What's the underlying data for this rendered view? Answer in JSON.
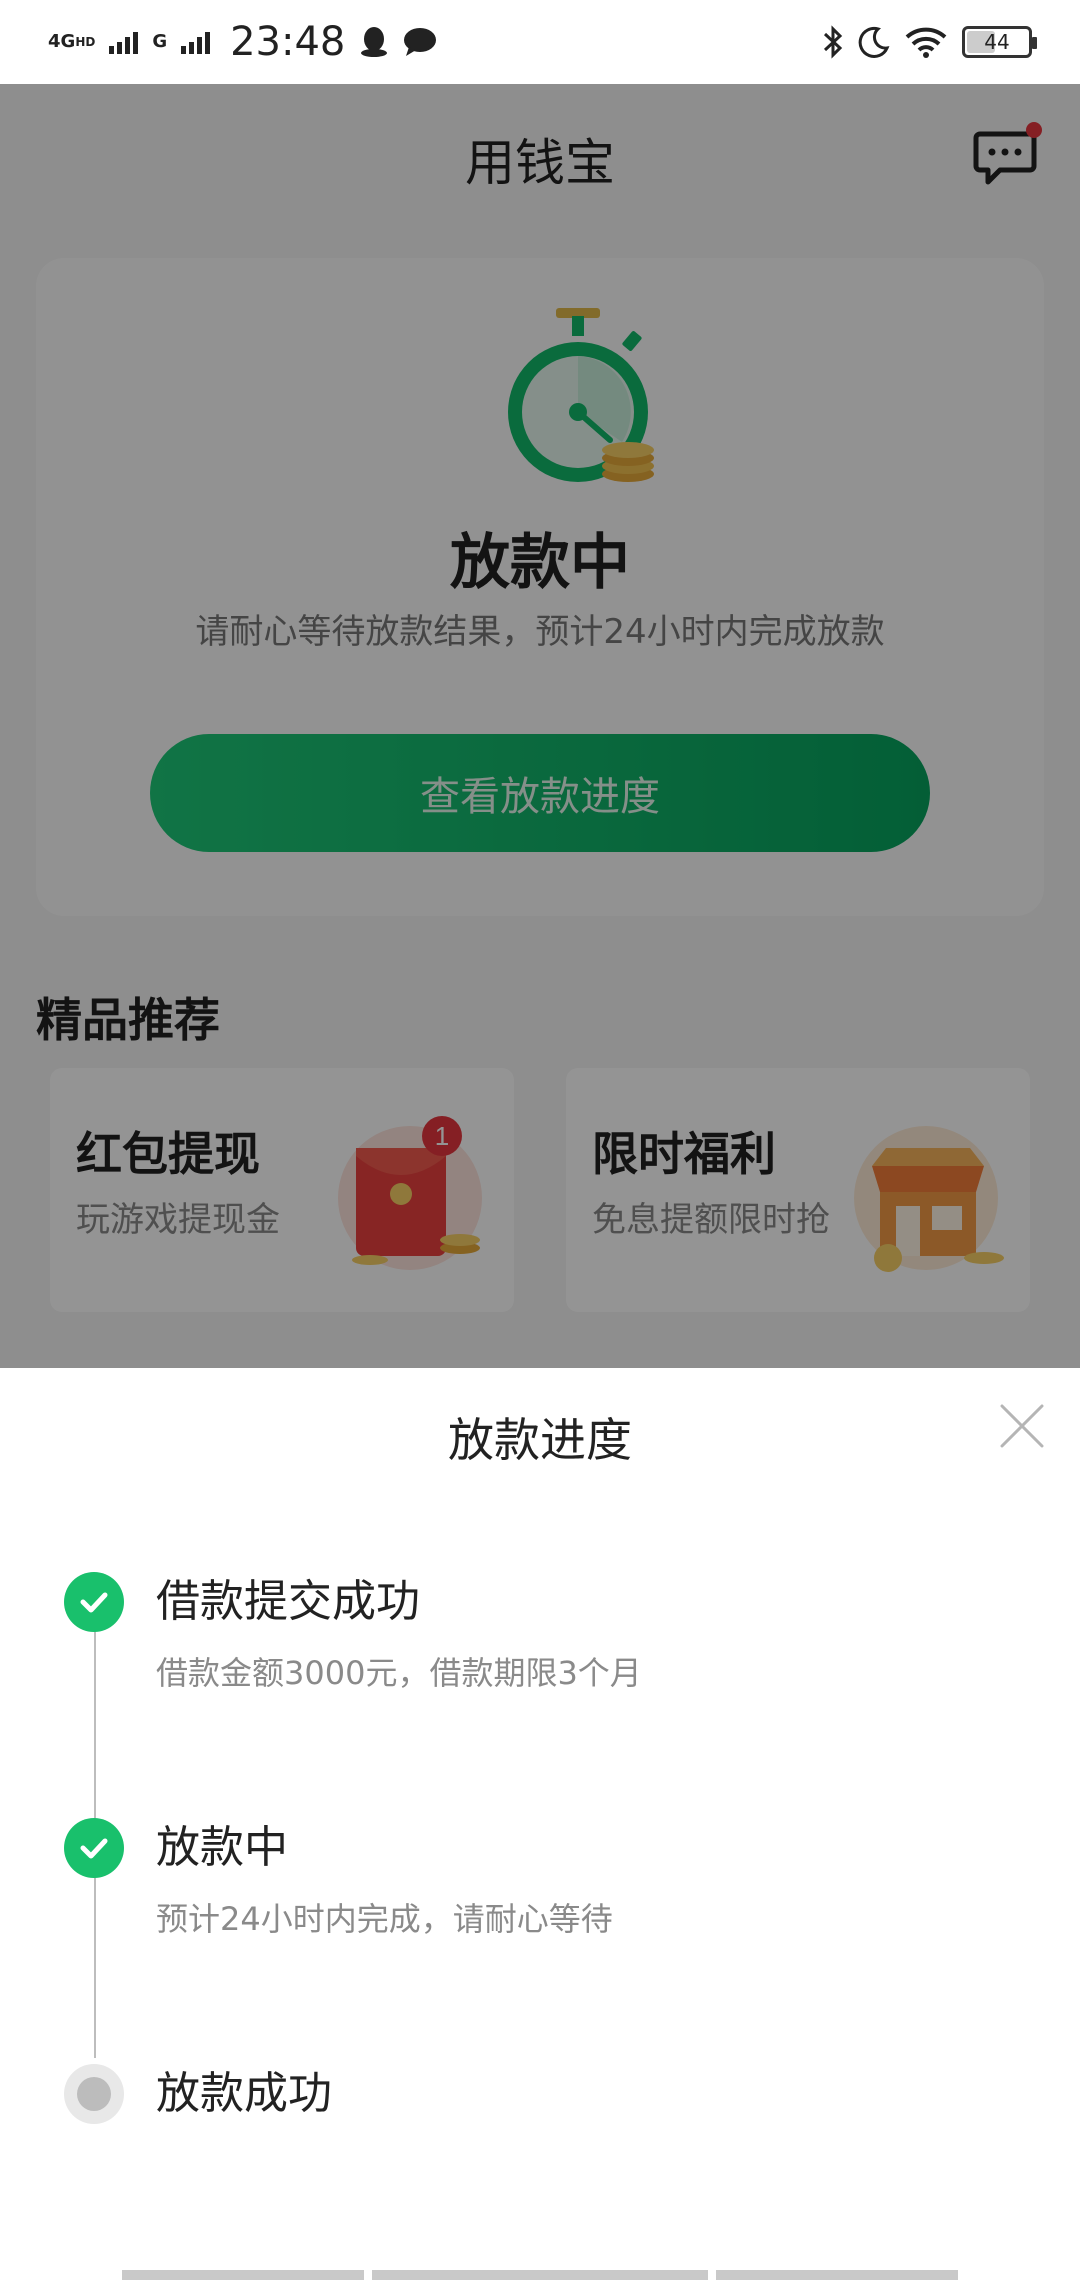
{
  "status_bar": {
    "network_1": "4G",
    "network_1_sup": "HD",
    "network_2": "G",
    "time": "23:48",
    "battery": "44",
    "icons": [
      "qq-icon",
      "chat-bubble-icon",
      "bluetooth-icon",
      "moon-icon",
      "wifi-icon",
      "battery-icon"
    ]
  },
  "header": {
    "title": "用钱宝",
    "message_icon": "message-icon",
    "badge_color": "#e5363e"
  },
  "status_card": {
    "icon": "stopwatch-coins-icon",
    "title": "放款中",
    "subtitle": "请耐心等待放款结果，预计24小时内完成放款",
    "button_label": "查看放款进度",
    "accent": "#12b86a"
  },
  "recommend": {
    "title": "精品推荐",
    "items": [
      {
        "name": "红包提现",
        "desc": "玩游戏提现金",
        "icon": "red-envelope-icon",
        "badge": "1"
      },
      {
        "name": "限时福利",
        "desc": "免息提额限时抢",
        "icon": "shop-icon"
      }
    ]
  },
  "sheet": {
    "title": "放款进度",
    "close_icon": "close-icon",
    "steps": [
      {
        "title": "借款提交成功",
        "desc": "借款金额3000元，借款期限3个月",
        "state": "done"
      },
      {
        "title": "放款中",
        "desc": "预计24小时内完成，请耐心等待",
        "state": "done"
      },
      {
        "title": "放款成功",
        "desc": "",
        "state": "pending"
      }
    ]
  }
}
